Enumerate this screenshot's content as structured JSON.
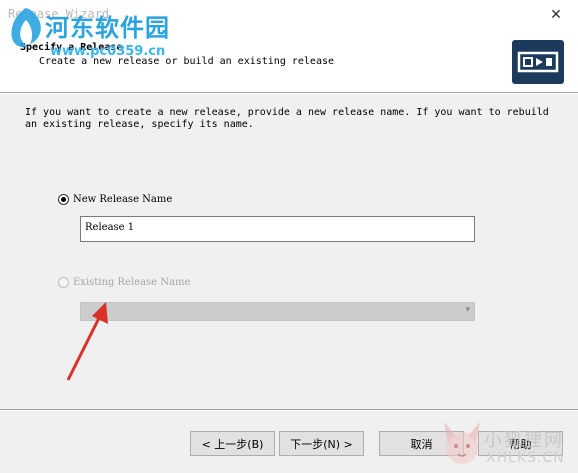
{
  "window": {
    "title": "Release Wizard",
    "close_glyph": "✕"
  },
  "header": {
    "title": "Specify a Release",
    "subtitle": "Create a new release or build an existing release",
    "icon": "wizard-icon"
  },
  "instructions": "If you want to create a new release, provide a new release name. If you want to rebuild\nan existing release, specify its name.",
  "new_release": {
    "label": "New Release Name",
    "checked": true,
    "value": "Release 1"
  },
  "existing_release": {
    "label": "Existing Release Name",
    "checked": false,
    "enabled": false,
    "selected": ""
  },
  "buttons": {
    "back": "< 上一步(B)",
    "next": "下一步(N) >",
    "cancel": "取消",
    "help": "帮助"
  },
  "watermarks": {
    "site_name": "河东软件园",
    "site_url": "www.pc0359.cn",
    "corner_name": "小狐狸网",
    "corner_url": "XHLKS.CN"
  },
  "colors": {
    "header_bg": "#ffffff",
    "body_bg": "#f0f0f0",
    "icon_bg": "#1b3a5c",
    "annotation_arrow": "#d9302a",
    "watermark_blue": "#2aa3e0"
  }
}
